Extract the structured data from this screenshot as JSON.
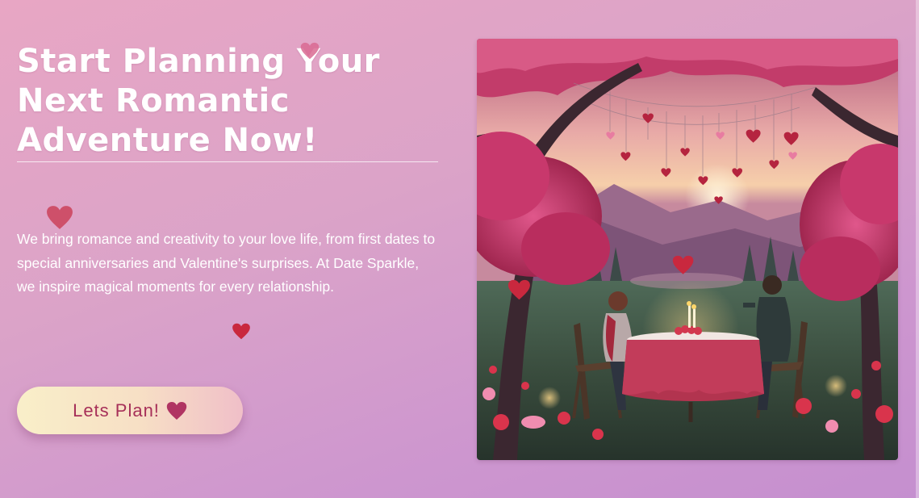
{
  "hero": {
    "headline": "Start Planning Your Next Romantic Adventure Now!",
    "intro": "We bring romance and creativity to your love life, from first dates to special anniversaries and Valentine's surprises. At Date Sparkle, we inspire magical moments for every relationship.",
    "cta_label": "Lets Plan!",
    "cta_icon": "heart-icon"
  },
  "image": {
    "subject": "romantic-dinner-illustration",
    "alt": "Couple dining at a candlelit table under blossoming pink trees with hanging hearts"
  },
  "colors": {
    "background_top": "#e8a6c4",
    "background_bottom": "#c58fcf",
    "headline": "#ffffff",
    "heart_red": "#c9283e",
    "cta_text": "#a62f58",
    "cta_heart": "#b03462"
  }
}
